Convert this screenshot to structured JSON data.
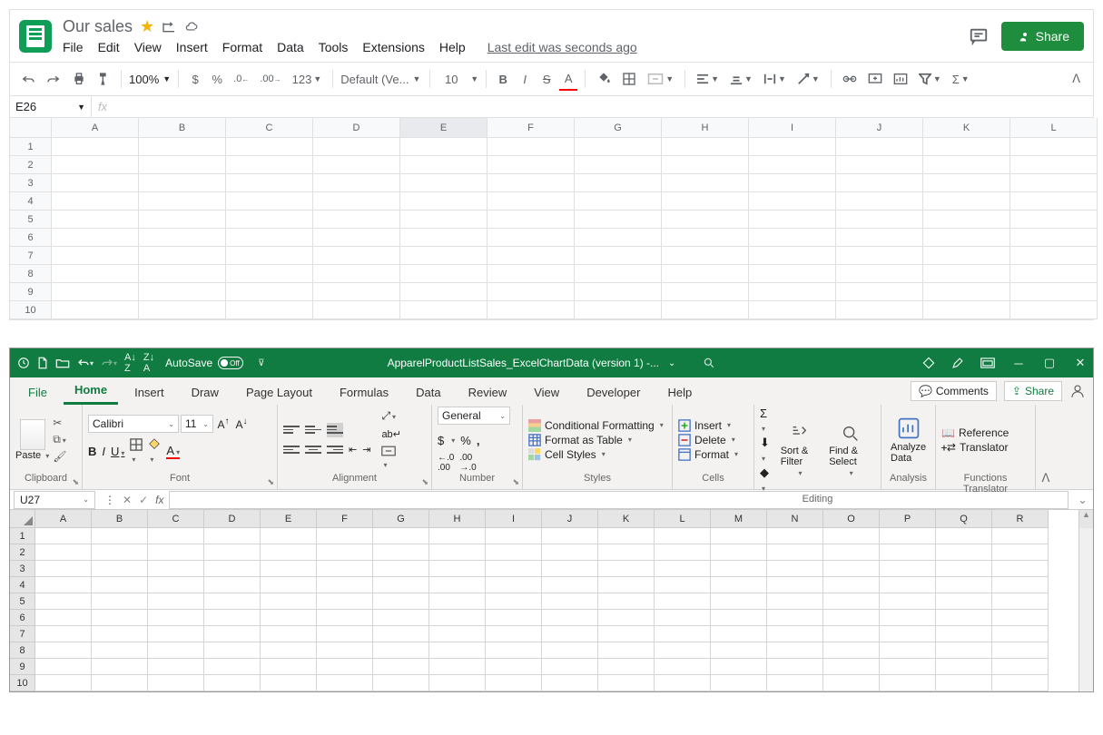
{
  "sheets": {
    "title": "Our sales",
    "menus": [
      "File",
      "Edit",
      "View",
      "Insert",
      "Format",
      "Data",
      "Tools",
      "Extensions",
      "Help"
    ],
    "last_edit": "Last edit was seconds ago",
    "share": "Share",
    "toolbar": {
      "zoom": "100%",
      "currency": "$",
      "percent": "%",
      "dec_dec": ".0",
      "inc_dec": ".00",
      "more_formats": "123",
      "font": "Default (Ve...",
      "font_size": "10",
      "bold": "B",
      "italic": "I",
      "strike": "S",
      "text_color": "A"
    },
    "namebox": "E26",
    "fx": "fx",
    "columns": [
      "A",
      "B",
      "C",
      "D",
      "E",
      "F",
      "G",
      "H",
      "I",
      "J",
      "K",
      "L"
    ],
    "rows": [
      "1",
      "2",
      "3",
      "4",
      "5",
      "6",
      "7",
      "8",
      "9",
      "10"
    ],
    "selected_col": "E"
  },
  "excel": {
    "qat": {
      "autosave_label": "AutoSave",
      "autosave_state": "Off"
    },
    "title": "ApparelProductListSales_ExcelChartData (version 1)  -...",
    "tabs": [
      "File",
      "Home",
      "Insert",
      "Draw",
      "Page Layout",
      "Formulas",
      "Data",
      "Review",
      "View",
      "Developer",
      "Help"
    ],
    "active_tab": "Home",
    "comments": "Comments",
    "share": "Share",
    "ribbon": {
      "clipboard": {
        "paste": "Paste",
        "label": "Clipboard"
      },
      "font": {
        "name": "Calibri",
        "size": "11",
        "bold": "B",
        "italic": "I",
        "underline": "U",
        "label": "Font"
      },
      "alignment": {
        "wrap": "ab",
        "label": "Alignment"
      },
      "number": {
        "format": "General",
        "currency": "$",
        "percent": "%",
        "comma": ",",
        "label": "Number"
      },
      "styles": {
        "cond": "Conditional Formatting",
        "table": "Format as Table",
        "cell": "Cell Styles",
        "label": "Styles"
      },
      "cells": {
        "insert": "Insert",
        "delete": "Delete",
        "format": "Format",
        "label": "Cells"
      },
      "editing": {
        "sort": "Sort & Filter",
        "find": "Find & Select",
        "label": "Editing"
      },
      "analysis": {
        "analyze": "Analyze Data",
        "label": "Analysis"
      },
      "addins": {
        "reference": "Reference",
        "translator": "Translator",
        "label": "Functions Translator"
      }
    },
    "namebox": "U27",
    "fx": "fx",
    "columns": [
      "A",
      "B",
      "C",
      "D",
      "E",
      "F",
      "G",
      "H",
      "I",
      "J",
      "K",
      "L",
      "M",
      "N",
      "O",
      "P",
      "Q",
      "R"
    ],
    "rows": [
      "1",
      "2",
      "3",
      "4",
      "5",
      "6",
      "7",
      "8",
      "9",
      "10"
    ]
  }
}
